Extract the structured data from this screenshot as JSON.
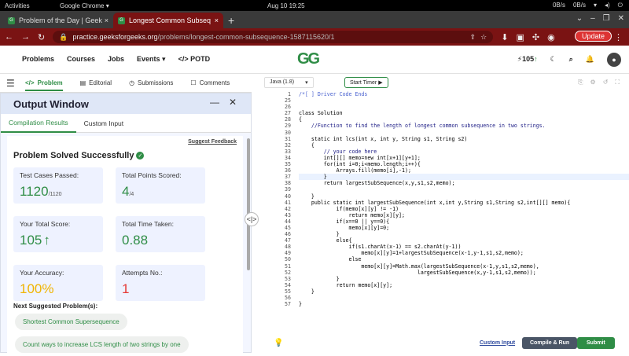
{
  "system": {
    "activities": "Activities",
    "app": "Google Chrome ▾",
    "clock": "Aug 10  19:25",
    "net_up": "0B/s",
    "net_down": "0B/s"
  },
  "browser": {
    "tabs": [
      {
        "label": "Problem of the Day | Geek",
        "active": false
      },
      {
        "label": "Longest Common Subseq",
        "active": true
      }
    ],
    "url_host": "practice.geeksforgeeks.org",
    "url_path": "/problems/longest-common-subsequence-1587115620/1",
    "update_label": "Update"
  },
  "site": {
    "nav": [
      "Problems",
      "Courses",
      "Jobs",
      "Events ▾",
      "</> POTD"
    ],
    "logo": "GG",
    "streak": "105"
  },
  "problem_tabs": [
    "Problem",
    "Editorial",
    "Submissions",
    "Comments"
  ],
  "output": {
    "title": "Output Window",
    "tabs": [
      "Compilation Results",
      "Custom Input"
    ],
    "feedback": "Suggest Feedback",
    "status": "Problem Solved Successfully",
    "cards": [
      {
        "label": "Test Cases Passed:",
        "value": "1120",
        "sub": "/1120",
        "color": "#2f8d46"
      },
      {
        "label": "Total Points Scored:",
        "value": "4",
        "sub": "/4",
        "color": "#2f8d46"
      },
      {
        "label": "Your Total Score:",
        "value": "105",
        "sub": "",
        "color": "#2f8d46"
      },
      {
        "label": "Total Time Taken:",
        "value": "0.88",
        "sub": "",
        "color": "#2f8d46"
      },
      {
        "label": "Your Accuracy:",
        "value": "100%",
        "sub": "",
        "color": "#f0b400"
      },
      {
        "label": "Attempts No.:",
        "value": "1",
        "sub": "",
        "color": "#e53935"
      }
    ],
    "next_label": "Next Suggested Problem(s):",
    "suggestions": [
      "Shortest Common Supersequence",
      "Count ways to increase LCS length of two strings by one"
    ]
  },
  "editor": {
    "language": "Java (1.8)",
    "timer": "Start Timer",
    "lines": [
      {
        "n": "1",
        "t": "/*[ ] Driver Code Ends",
        "c": "cmg"
      },
      {
        "n": "25",
        "t": "",
        "c": ""
      },
      {
        "n": "26",
        "t": "",
        "c": ""
      },
      {
        "n": "27",
        "t": "class Solution",
        "c": ""
      },
      {
        "n": "28",
        "t": "{",
        "c": ""
      },
      {
        "n": "29",
        "t": "    //Function to find the length of longest common subsequence in two strings.",
        "c": "cm"
      },
      {
        "n": "30",
        "t": "",
        "c": ""
      },
      {
        "n": "31",
        "t": "    static int lcs(int x, int y, String s1, String s2)",
        "c": ""
      },
      {
        "n": "32",
        "t": "    {",
        "c": ""
      },
      {
        "n": "33",
        "t": "        // your code here",
        "c": "cm"
      },
      {
        "n": "34",
        "t": "        int[][] memo=new int[x+1][y+1];",
        "c": ""
      },
      {
        "n": "35",
        "t": "        for(int i=0;i<memo.length;i++){",
        "c": ""
      },
      {
        "n": "36",
        "t": "            Arrays.fill(memo[i],-1);",
        "c": ""
      },
      {
        "n": "37",
        "t": "        }",
        "c": "curl"
      },
      {
        "n": "38",
        "t": "        return largestSubSequence(x,y,s1,s2,memo);",
        "c": ""
      },
      {
        "n": "39",
        "t": "",
        "c": ""
      },
      {
        "n": "40",
        "t": "    }",
        "c": ""
      },
      {
        "n": "41",
        "t": "    public static int largestSubSequence(int x,int y,String s1,String s2,int[][] memo){",
        "c": ""
      },
      {
        "n": "42",
        "t": "            if(memo[x][y] != -1)",
        "c": ""
      },
      {
        "n": "43",
        "t": "                return memo[x][y];",
        "c": ""
      },
      {
        "n": "44",
        "t": "            if(x==0 || y==0){",
        "c": ""
      },
      {
        "n": "45",
        "t": "                memo[x][y]=0;",
        "c": ""
      },
      {
        "n": "46",
        "t": "            }",
        "c": ""
      },
      {
        "n": "47",
        "t": "            else{",
        "c": ""
      },
      {
        "n": "48",
        "t": "                if(s1.charAt(x-1) == s2.charAt(y-1))",
        "c": ""
      },
      {
        "n": "49",
        "t": "                    memo[x][y]=1+largestSubSequence(x-1,y-1,s1,s2,memo);",
        "c": ""
      },
      {
        "n": "50",
        "t": "                else",
        "c": ""
      },
      {
        "n": "51",
        "t": "                    memo[x][y]=Math.max(largestSubSequence(x-1,y,s1,s2,memo),",
        "c": ""
      },
      {
        "n": "52",
        "t": "                                      largestSubSequence(x,y-1,s1,s2,memo));",
        "c": ""
      },
      {
        "n": "53",
        "t": "            }",
        "c": ""
      },
      {
        "n": "54",
        "t": "            return memo[x][y];",
        "c": ""
      },
      {
        "n": "55",
        "t": "    }",
        "c": ""
      },
      {
        "n": "56",
        "t": "",
        "c": ""
      },
      {
        "n": "57",
        "t": "}",
        "c": ""
      }
    ],
    "custom_input": "Custom Input",
    "compile_run": "Compile & Run",
    "submit": "Submit"
  }
}
